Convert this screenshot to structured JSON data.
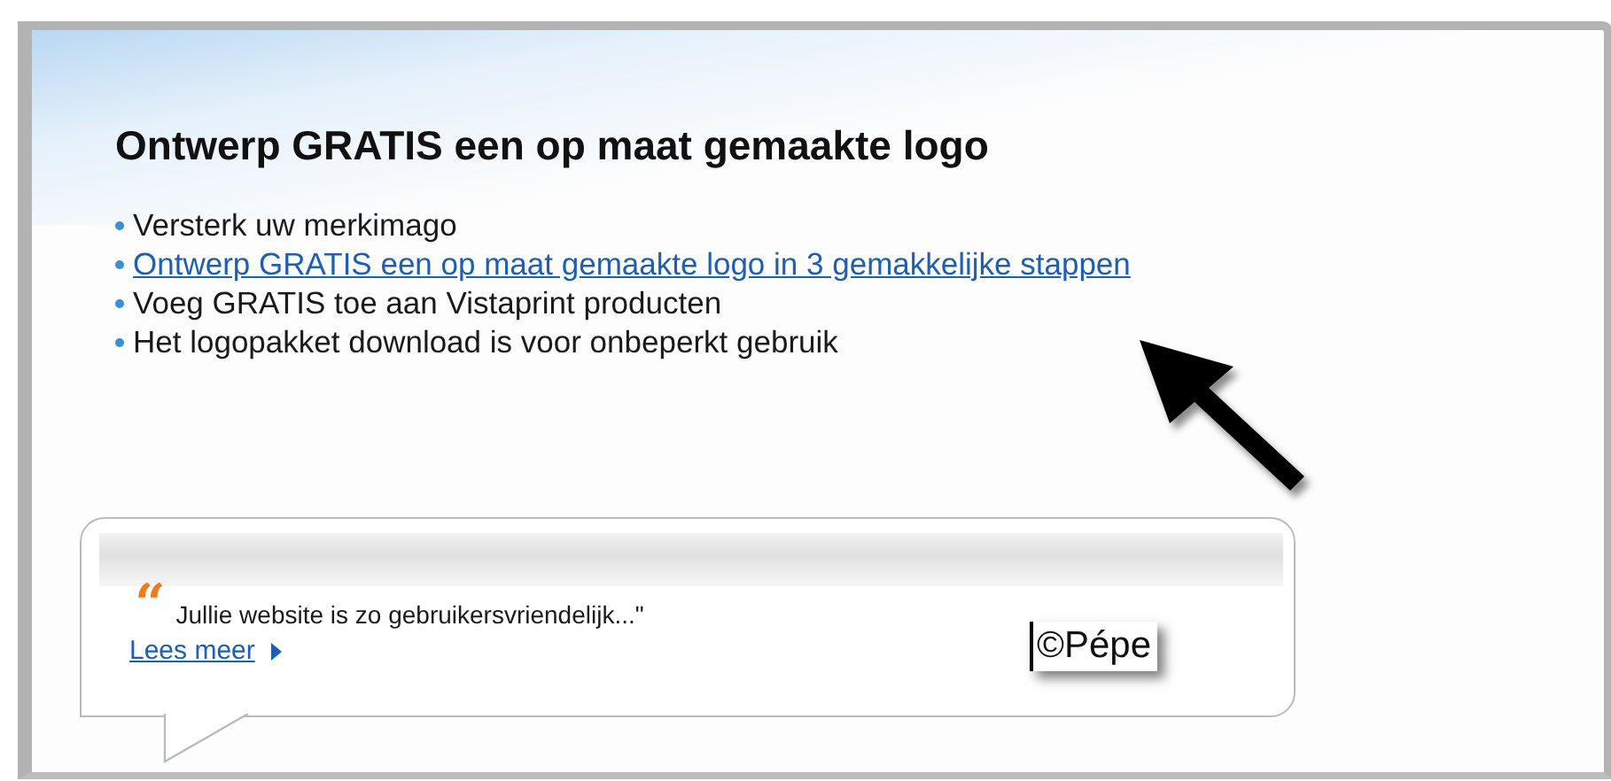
{
  "heading": "Ontwerp GRATIS een op maat gemaakte logo",
  "features": [
    {
      "kind": "text",
      "text": "Versterk uw merkimago"
    },
    {
      "kind": "link",
      "text": "Ontwerp GRATIS een op maat gemaakte logo in 3 gemakkelijke stappen"
    },
    {
      "kind": "text",
      "text": "Voeg GRATIS toe aan Vistaprint producten"
    },
    {
      "kind": "text",
      "text": "Het logopakket download is voor onbeperkt gebruik"
    }
  ],
  "testimonial": {
    "quote_mark": "“",
    "text": "Jullie website is zo gebruikersvriendelijk...\"",
    "link": "Lees meer"
  },
  "watermark_label": "©Pépe"
}
